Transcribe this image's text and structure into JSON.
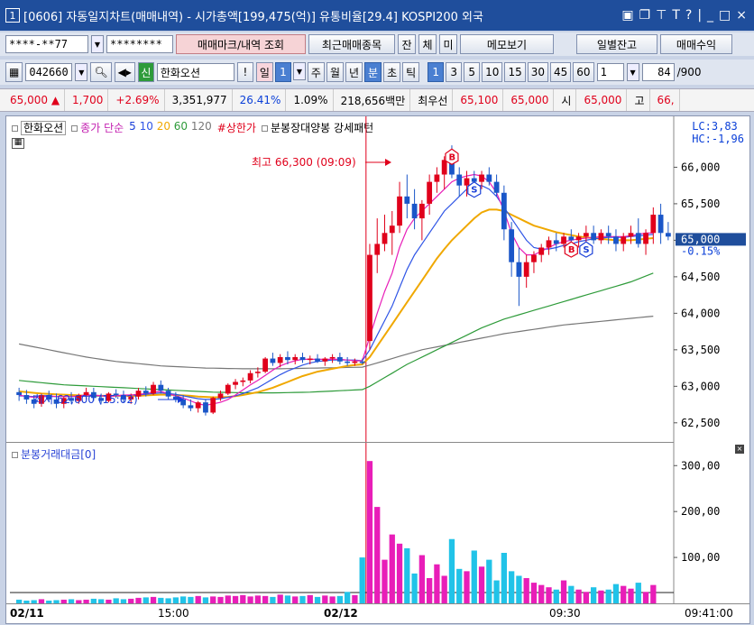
{
  "window": {
    "number": "1",
    "title": "[0606] 자동일지차트(매매내역) - 시가총액[199,475(억)] 유통비율[29.4] KOSPI200 외국",
    "icons": [
      "window-icon",
      "copy-icon",
      "pin-icon",
      "text-icon",
      "help-icon",
      "minimize-icon",
      "restore-icon",
      "close-icon"
    ]
  },
  "account_row": {
    "account_value": "****-**77",
    "password_value": "********",
    "btn_trade_marks": "매매마크/내역 조회",
    "btn_recent": "최근매매종목",
    "btn_jan": "잔",
    "btn_che": "체",
    "btn_mi": "미",
    "btn_memo": "메모보기",
    "btn_daily_balance": "일별잔고",
    "btn_trade_profit": "매매수익"
  },
  "stock_row": {
    "code": "042660",
    "badge": "신",
    "name": "한화오션",
    "btn_excl": "!",
    "period_buttons": [
      {
        "label": "일",
        "active": false,
        "pink": true
      },
      {
        "label": "1",
        "active": true
      },
      {
        "label": "주",
        "active": false
      },
      {
        "label": "월",
        "active": false
      },
      {
        "label": "년",
        "active": false
      },
      {
        "label": "분",
        "active": true
      },
      {
        "label": "초",
        "active": false
      },
      {
        "label": "틱",
        "active": false
      }
    ],
    "interval_buttons": [
      "1",
      "3",
      "5",
      "10",
      "15",
      "30",
      "45",
      "60"
    ],
    "interval_active": "1",
    "count_value": "1",
    "range_value": "84",
    "range_total": "/900"
  },
  "quote_row": {
    "price": "65,000",
    "change": "1,700",
    "change_pct": "+2.69%",
    "volume": "3,351,977",
    "ratio1": "26.41%",
    "ratio2": "1.09%",
    "amount": "218,656백만",
    "best_ask_label": "최우선",
    "best_ask1": "65,100",
    "best_ask2": "65,000",
    "open_label": "시",
    "open_value": "65,000",
    "high_label": "고",
    "high_value": "66,"
  },
  "price_legend": {
    "name": "한화오션",
    "ma_label": "종가 단순",
    "ma_periods": [
      "5",
      "10",
      "20",
      "60",
      "120"
    ],
    "ma_colors": [
      "#1a3fd8",
      "#2f55e6",
      "#f0a800",
      "#2e9b3a",
      "#777777"
    ],
    "limit_label": "#상한가",
    "pattern_label": "분봉장대양봉 강세패턴",
    "lc": "LC:3,83",
    "hc": "HC:-1,96"
  },
  "price_axis": {
    "ticks": [
      "66,000",
      "65,500",
      "65,000",
      "64,500",
      "64,000",
      "63,500",
      "63,000",
      "62,500"
    ],
    "current_price": "65,000",
    "current_pct": "-0.15%"
  },
  "annotations": {
    "high": "최고 66,300 (09:09)",
    "low": "최저 62,600 (15:02)"
  },
  "volume_legend": {
    "label": "분봉거래대금[0]"
  },
  "volume_axis": {
    "ticks": [
      "300,00",
      "200,00",
      "100,00"
    ]
  },
  "x_axis": {
    "labels": [
      "02/11",
      "15:00",
      "02/12",
      "09:30"
    ],
    "time_readout": "09:41:00"
  },
  "colors": {
    "up": "#e0001b",
    "down": "#1a56c8",
    "vol_up": "#e81eb8",
    "vol_down": "#21c3e8"
  },
  "chart_data": {
    "type": "candlestick",
    "ylim": [
      62300,
      66450
    ],
    "candles": [
      [
        62920,
        62980,
        62800,
        62880
      ],
      [
        62880,
        62950,
        62760,
        62820
      ],
      [
        62820,
        62880,
        62700,
        62760
      ],
      [
        62760,
        62900,
        62720,
        62880
      ],
      [
        62880,
        62940,
        62780,
        62820
      ],
      [
        62820,
        62900,
        62700,
        62760
      ],
      [
        62760,
        62860,
        62700,
        62840
      ],
      [
        62840,
        62920,
        62760,
        62800
      ],
      [
        62800,
        62900,
        62760,
        62880
      ],
      [
        62880,
        62980,
        62820,
        62920
      ],
      [
        62920,
        62980,
        62800,
        62840
      ],
      [
        62840,
        62900,
        62760,
        62800
      ],
      [
        62800,
        62920,
        62780,
        62900
      ],
      [
        62900,
        62960,
        62840,
        62880
      ],
      [
        62880,
        62940,
        62780,
        62820
      ],
      [
        62820,
        62900,
        62760,
        62860
      ],
      [
        62860,
        62980,
        62820,
        62940
      ],
      [
        62940,
        63000,
        62860,
        62900
      ],
      [
        62900,
        63060,
        62880,
        63020
      ],
      [
        63020,
        63080,
        62900,
        62940
      ],
      [
        62940,
        62980,
        62820,
        62860
      ],
      [
        62860,
        62920,
        62780,
        62820
      ],
      [
        62820,
        62880,
        62700,
        62740
      ],
      [
        62740,
        62820,
        62660,
        62700
      ],
      [
        62700,
        62800,
        62640,
        62780
      ],
      [
        62780,
        62820,
        62600,
        62640
      ],
      [
        62640,
        62860,
        62620,
        62840
      ],
      [
        62840,
        62940,
        62800,
        62900
      ],
      [
        62900,
        63040,
        62880,
        63020
      ],
      [
        63020,
        63100,
        62960,
        63060
      ],
      [
        63060,
        63120,
        63000,
        63080
      ],
      [
        63080,
        63220,
        63040,
        63180
      ],
      [
        63180,
        63260,
        63120,
        63200
      ],
      [
        63200,
        63400,
        63180,
        63380
      ],
      [
        63380,
        63460,
        63280,
        63320
      ],
      [
        63320,
        63440,
        63260,
        63400
      ],
      [
        63400,
        63480,
        63300,
        63360
      ],
      [
        63360,
        63440,
        63300,
        63400
      ],
      [
        63400,
        63460,
        63320,
        63360
      ],
      [
        63360,
        63420,
        63300,
        63380
      ],
      [
        63380,
        63440,
        63320,
        63340
      ],
      [
        63340,
        63400,
        63280,
        63380
      ],
      [
        63380,
        63440,
        63320,
        63400
      ],
      [
        63400,
        63460,
        63300,
        63340
      ],
      [
        63340,
        63400,
        63280,
        63320
      ],
      [
        63320,
        63380,
        63280,
        63340
      ],
      [
        63340,
        63380,
        63300,
        63320
      ],
      [
        63620,
        64950,
        63500,
        64800
      ],
      [
        64800,
        65300,
        64550,
        64950
      ],
      [
        64950,
        65350,
        64850,
        65100
      ],
      [
        65100,
        65400,
        64800,
        65200
      ],
      [
        65200,
        65800,
        65100,
        65600
      ],
      [
        65600,
        65900,
        65300,
        65500
      ],
      [
        65500,
        65700,
        65150,
        65300
      ],
      [
        65300,
        65550,
        65000,
        65500
      ],
      [
        65500,
        65900,
        65350,
        65800
      ],
      [
        65800,
        66000,
        65650,
        65900
      ],
      [
        65900,
        66150,
        65700,
        66100
      ],
      [
        66100,
        66300,
        65850,
        65900
      ],
      [
        65900,
        66000,
        65600,
        65750
      ],
      [
        65750,
        65950,
        65600,
        65850
      ],
      [
        65850,
        65950,
        65650,
        65800
      ],
      [
        65800,
        65950,
        65700,
        65900
      ],
      [
        65900,
        66000,
        65750,
        65800
      ],
      [
        65800,
        65900,
        65600,
        65650
      ],
      [
        65650,
        65750,
        65000,
        65150
      ],
      [
        65150,
        65250,
        64500,
        64700
      ],
      [
        64700,
        64900,
        64100,
        64500
      ],
      [
        64500,
        64800,
        64350,
        64700
      ],
      [
        64700,
        64850,
        64550,
        64800
      ],
      [
        64800,
        64950,
        64700,
        64900
      ],
      [
        64900,
        65050,
        64800,
        65000
      ],
      [
        65000,
        65100,
        64850,
        64950
      ],
      [
        64950,
        65100,
        64900,
        65050
      ],
      [
        65050,
        65150,
        64950,
        65000
      ],
      [
        65000,
        65100,
        64900,
        65050
      ],
      [
        65050,
        65200,
        64950,
        65100
      ],
      [
        65100,
        65200,
        64950,
        65000
      ],
      [
        65000,
        65150,
        64950,
        65100
      ],
      [
        65100,
        65200,
        64950,
        65050
      ],
      [
        65050,
        65150,
        64850,
        64950
      ],
      [
        64950,
        65100,
        64850,
        65050
      ],
      [
        65050,
        65200,
        64950,
        65100
      ],
      [
        65100,
        65300,
        64900,
        64950
      ],
      [
        64950,
        65150,
        64800,
        65100
      ],
      [
        65100,
        65450,
        64950,
        65350
      ],
      [
        65350,
        65500,
        64950,
        65100
      ],
      [
        65100,
        65250,
        65000,
        65050
      ]
    ],
    "volume": [
      8,
      6,
      7,
      9,
      6,
      7,
      8,
      9,
      7,
      8,
      10,
      9,
      8,
      11,
      9,
      10,
      12,
      13,
      14,
      12,
      11,
      13,
      15,
      14,
      16,
      13,
      15,
      14,
      17,
      16,
      18,
      15,
      17,
      16,
      14,
      19,
      17,
      15,
      16,
      18,
      14,
      17,
      15,
      16,
      25,
      18,
      100,
      310,
      210,
      95,
      150,
      130,
      120,
      65,
      105,
      55,
      85,
      60,
      140,
      75,
      70,
      115,
      80,
      95,
      50,
      110,
      70,
      60,
      55,
      45,
      40,
      35,
      30,
      50,
      38,
      30,
      25,
      35,
      28,
      30,
      42,
      38,
      32,
      45,
      25,
      40
    ],
    "ma": {
      "ma5": [
        62880,
        62860,
        62850,
        62860,
        62870,
        62860,
        62860,
        62860,
        62870,
        62880,
        62880,
        62870,
        62860,
        62870,
        62880,
        62880,
        62890,
        62900,
        62920,
        62930,
        62900,
        62870,
        62840,
        62800,
        62760,
        62740,
        62760,
        62780,
        62820,
        62880,
        62950,
        63020,
        63080,
        63150,
        63220,
        63280,
        63320,
        63350,
        63370,
        63370,
        63370,
        63370,
        63370,
        63370,
        63360,
        63350,
        63350,
        63680,
        64000,
        64300,
        64550,
        64900,
        65150,
        65300,
        65400,
        65500,
        65600,
        65700,
        65800,
        65850,
        65880,
        65900,
        65880,
        65800,
        65650,
        65400,
        65100,
        64900,
        64800,
        64800,
        64850,
        64900,
        64950,
        64980,
        65000,
        65020,
        65030,
        65040,
        65050,
        65050,
        65050,
        65050,
        65060,
        65080,
        65100,
        65100
      ],
      "ma10": [
        62870,
        62865,
        62860,
        62858,
        62860,
        62860,
        62860,
        62860,
        62860,
        62865,
        62870,
        62870,
        62870,
        62870,
        62875,
        62880,
        62880,
        62890,
        62900,
        62910,
        62900,
        62890,
        62870,
        62850,
        62830,
        62820,
        62820,
        62830,
        62850,
        62870,
        62900,
        62940,
        62980,
        63040,
        63100,
        63160,
        63210,
        63250,
        63290,
        63320,
        63340,
        63350,
        63360,
        63360,
        63360,
        63360,
        63350,
        63500,
        63700,
        63900,
        64100,
        64350,
        64600,
        64800,
        64950,
        65100,
        65250,
        65400,
        65500,
        65600,
        65700,
        65750,
        65750,
        65700,
        65600,
        65450,
        65300,
        65150,
        65000,
        64900,
        64880,
        64880,
        64900,
        64930,
        64950,
        64980,
        65000,
        65020,
        65030,
        65040,
        65040,
        65040,
        65050,
        65060,
        65070,
        65080
      ],
      "ma20": [
        62930,
        62920,
        62910,
        62900,
        62895,
        62890,
        62885,
        62880,
        62875,
        62870,
        62870,
        62870,
        62870,
        62870,
        62870,
        62870,
        62870,
        62875,
        62880,
        62885,
        62885,
        62880,
        62875,
        62870,
        62860,
        62855,
        62850,
        62850,
        62855,
        62865,
        62880,
        62900,
        62920,
        62950,
        62980,
        63020,
        63060,
        63100,
        63140,
        63170,
        63200,
        63220,
        63240,
        63260,
        63280,
        63290,
        63300,
        63400,
        63550,
        63700,
        63850,
        64000,
        64150,
        64300,
        64450,
        64600,
        64750,
        64880,
        65000,
        65100,
        65200,
        65300,
        65380,
        65420,
        65420,
        65400,
        65350,
        65300,
        65250,
        65200,
        65170,
        65140,
        65110,
        65090,
        65070,
        65050,
        65040,
        65030,
        65020,
        65010,
        65000,
        65000,
        65000,
        65010,
        65020,
        65030
      ],
      "ma60": [
        63080,
        63070,
        63060,
        63050,
        63040,
        63030,
        63020,
        63015,
        63010,
        63005,
        63000,
        62995,
        62990,
        62985,
        62980,
        62975,
        62970,
        62965,
        62960,
        62955,
        62950,
        62945,
        62940,
        62935,
        62930,
        62925,
        62920,
        62918,
        62916,
        62914,
        62912,
        62910,
        62910,
        62910,
        62910,
        62912,
        62914,
        62916,
        62918,
        62920,
        62925,
        62930,
        62935,
        62940,
        62945,
        62950,
        62955,
        63000,
        63060,
        63120,
        63180,
        63240,
        63300,
        63350,
        63400,
        63450,
        63500,
        63550,
        63600,
        63650,
        63700,
        63750,
        63800,
        63840,
        63880,
        63920,
        63950,
        63980,
        64010,
        64040,
        64070,
        64100,
        64130,
        64160,
        64190,
        64220,
        64250,
        64280,
        64310,
        64340,
        64370,
        64400,
        64430,
        64470,
        64510,
        64550
      ],
      "ma120": [
        63580,
        63560,
        63540,
        63520,
        63500,
        63480,
        63460,
        63440,
        63420,
        63400,
        63385,
        63370,
        63355,
        63340,
        63330,
        63320,
        63310,
        63300,
        63290,
        63280,
        63275,
        63270,
        63265,
        63260,
        63255,
        63250,
        63248,
        63246,
        63244,
        63242,
        63240,
        63240,
        63240,
        63240,
        63240,
        63240,
        63242,
        63244,
        63246,
        63248,
        63250,
        63252,
        63254,
        63256,
        63258,
        63260,
        63262,
        63290,
        63320,
        63350,
        63380,
        63410,
        63440,
        63470,
        63500,
        63520,
        63540,
        63560,
        63580,
        63600,
        63620,
        63640,
        63660,
        63680,
        63700,
        63720,
        63735,
        63750,
        63765,
        63780,
        63795,
        63810,
        63825,
        63840,
        63850,
        63860,
        63870,
        63880,
        63890,
        63900,
        63910,
        63920,
        63930,
        63940,
        63950,
        63960
      ]
    }
  }
}
